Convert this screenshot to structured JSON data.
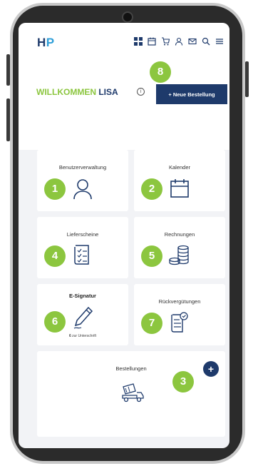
{
  "header": {
    "logo_h": "H",
    "logo_p": "P",
    "icons": [
      "grid-icon",
      "calendar-icon",
      "cart-icon",
      "user-icon",
      "mail-icon",
      "search-icon",
      "menu-icon"
    ]
  },
  "welcome": {
    "prefix": "WILLKOMMEN",
    "name": "LISA",
    "info": "i",
    "new_order_label": "+ Neue Bestellung"
  },
  "cards": [
    {
      "title": "Benutzerverwaltung",
      "badge": "1",
      "icon": "user-icon"
    },
    {
      "title": "Kalender",
      "badge": "2",
      "icon": "calendar-icon"
    },
    {
      "title": "Lieferscheine",
      "badge": "4",
      "icon": "checklist-icon"
    },
    {
      "title": "Rechnungen",
      "badge": "5",
      "icon": "coins-icon"
    },
    {
      "title": "E-Signatur",
      "badge": "6",
      "icon": "pen-icon",
      "sub_count": "6",
      "sub_text": "zur Unterschrift"
    },
    {
      "title": "Rückvergütungen",
      "badge": "7",
      "icon": "refund-document-icon"
    },
    {
      "title": "Bestellungen",
      "badge": "3",
      "icon": "concrete-mixer-icon",
      "plus": "+"
    }
  ],
  "new_order_badge": "8",
  "colors": {
    "brand_dark": "#1e3a6b",
    "brand_green": "#8cc63f",
    "brand_blue": "#2f9fd8"
  }
}
